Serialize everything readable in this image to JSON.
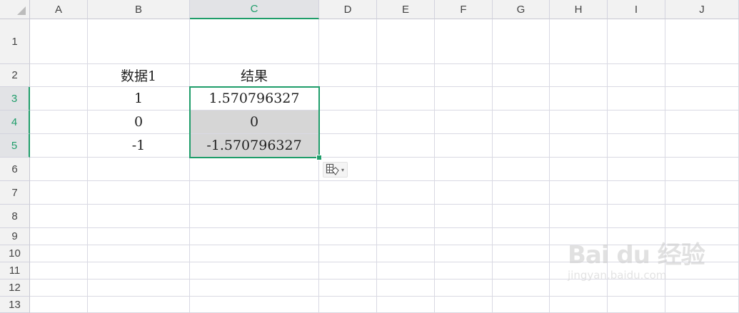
{
  "columns": [
    "A",
    "B",
    "C",
    "D",
    "E",
    "F",
    "G",
    "H",
    "I",
    "J"
  ],
  "rows": [
    "1",
    "2",
    "3",
    "4",
    "5",
    "6",
    "7",
    "8",
    "9",
    "10",
    "11",
    "12",
    "13"
  ],
  "selection": {
    "columns": [
      "C"
    ],
    "rows": [
      "3",
      "4",
      "5"
    ]
  },
  "cells": [
    {
      "ref": "B2",
      "value": "数据1"
    },
    {
      "ref": "C2",
      "value": "结果"
    },
    {
      "ref": "B3",
      "value": "1"
    },
    {
      "ref": "C3",
      "value": "1.570796327"
    },
    {
      "ref": "B4",
      "value": "0"
    },
    {
      "ref": "C4",
      "value": "0",
      "shaded": true
    },
    {
      "ref": "B5",
      "value": "-1"
    },
    {
      "ref": "C5",
      "value": "-1.570796327",
      "shaded": true
    }
  ],
  "paste_options": {
    "icon": "paste-options-icon",
    "caret": "▾"
  },
  "watermark": {
    "logo_text": "Bai du 经验",
    "url": "jingyan.baidu.com"
  },
  "colors": {
    "selection": "#1f9d6a",
    "gridline": "#d9d9e3",
    "header_bg": "#f2f2f2",
    "shade": "#d6d6d6"
  }
}
